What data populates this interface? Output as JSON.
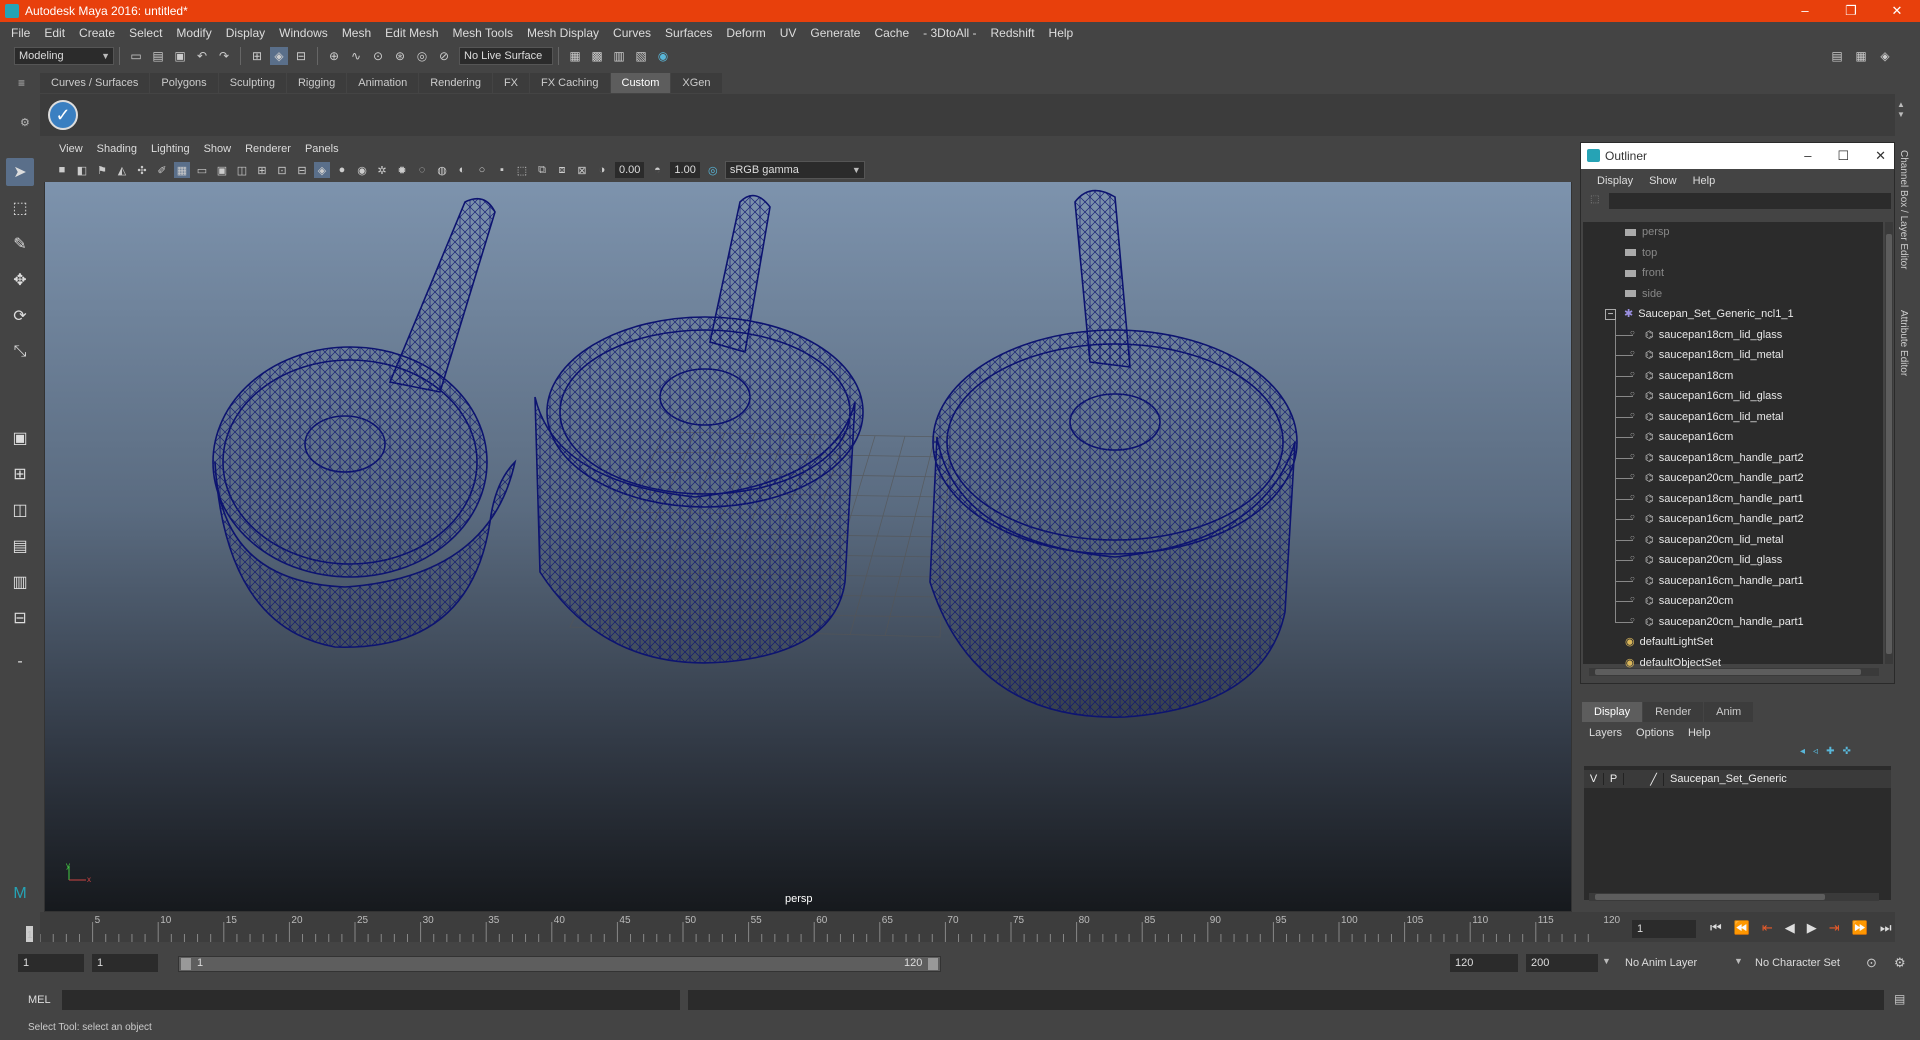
{
  "window": {
    "title": "Autodesk Maya 2016: untitled*",
    "controls": [
      "–",
      "❐",
      "✕"
    ]
  },
  "menubar": [
    "File",
    "Edit",
    "Create",
    "Select",
    "Modify",
    "Display",
    "Windows",
    "Mesh",
    "Edit Mesh",
    "Mesh Tools",
    "Mesh Display",
    "Curves",
    "Surfaces",
    "Deform",
    "UV",
    "Generate",
    "Cache",
    "- 3DtoAll -",
    "Redshift",
    "Help"
  ],
  "toolbar": {
    "mode": "Modeling",
    "live_surface": "No Live Surface"
  },
  "shelf": {
    "tabs": [
      "Curves / Surfaces",
      "Polygons",
      "Sculpting",
      "Rigging",
      "Animation",
      "Rendering",
      "FX",
      "FX Caching",
      "Custom",
      "XGen"
    ],
    "active_tab": "Custom"
  },
  "viewport": {
    "menu": [
      "View",
      "Shading",
      "Lighting",
      "Show",
      "Renderer",
      "Panels"
    ],
    "exposure": "0.00",
    "gamma": "1.00",
    "color_space": "sRGB gamma",
    "camera": "persp"
  },
  "outliner": {
    "title": "Outliner",
    "menu": [
      "Display",
      "Show",
      "Help"
    ],
    "cameras": [
      "persp",
      "top",
      "front",
      "side"
    ],
    "group": "Saucepan_Set_Generic_ncl1_1",
    "children": [
      "saucepan18cm_lid_glass",
      "saucepan18cm_lid_metal",
      "saucepan18cm",
      "saucepan16cm_lid_glass",
      "saucepan16cm_lid_metal",
      "saucepan16cm",
      "saucepan18cm_handle_part2",
      "saucepan20cm_handle_part2",
      "saucepan18cm_handle_part1",
      "saucepan16cm_handle_part2",
      "saucepan20cm_lid_metal",
      "saucepan20cm_lid_glass",
      "saucepan16cm_handle_part1",
      "saucepan20cm",
      "saucepan20cm_handle_part1"
    ],
    "sets": [
      "defaultLightSet",
      "defaultObjectSet"
    ]
  },
  "layer_editor": {
    "tabs": [
      "Display",
      "Render",
      "Anim"
    ],
    "active_tab": "Display",
    "menu": [
      "Layers",
      "Options",
      "Help"
    ],
    "layer": {
      "v": "V",
      "p": "P",
      "name": "Saucepan_Set_Generic"
    }
  },
  "side_tabs": [
    "Channel Box / Layer Editor",
    "Attribute Editor"
  ],
  "timeline": {
    "ticks": [
      "5",
      "10",
      "15",
      "20",
      "25",
      "30",
      "35",
      "40",
      "45",
      "50",
      "55",
      "60",
      "65",
      "70",
      "75",
      "80",
      "85",
      "90",
      "95",
      "100",
      "105",
      "110",
      "115",
      "120"
    ],
    "first": "1",
    "current_frame": "1"
  },
  "range": {
    "start": "1",
    "start2": "1",
    "slider_start": "1",
    "slider_end": "120",
    "end": "120",
    "end2": "200",
    "anim_layer": "No Anim Layer",
    "character_set": "No Character Set"
  },
  "cmdline": {
    "label": "MEL"
  },
  "help_line": "Select Tool: select an object"
}
